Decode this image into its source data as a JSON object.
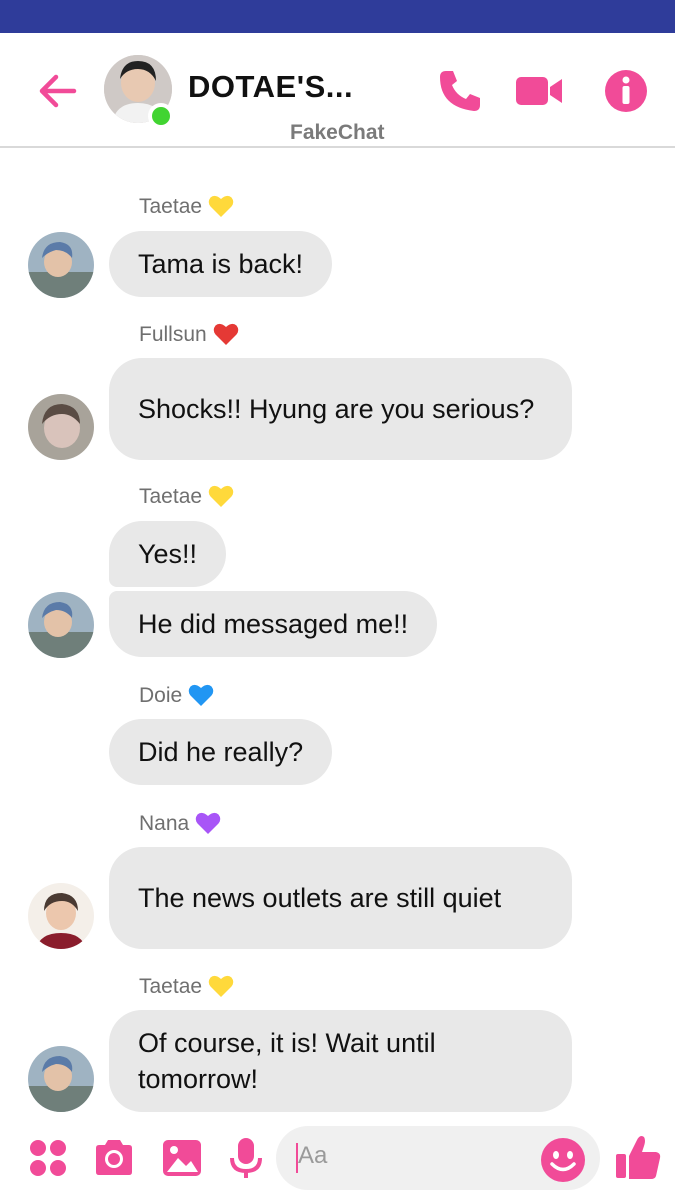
{
  "header": {
    "title": "DOTAE'S...",
    "subtitle": "FakeChat",
    "online": true,
    "accent_color": "#f14b98",
    "icons": [
      "back-arrow-icon",
      "phone-icon",
      "video-camera-icon",
      "info-icon"
    ]
  },
  "messages": [
    {
      "sender": "Taetae",
      "heart_color": "#ffd93b",
      "texts": [
        "Tama is back!"
      ]
    },
    {
      "sender": "Fullsun",
      "heart_color": "#e53935",
      "texts": [
        "Shocks!!  Hyung are you serious?"
      ]
    },
    {
      "sender": "Taetae",
      "heart_color": "#ffd93b",
      "texts": [
        "Yes!!",
        "He did messaged me!!"
      ]
    },
    {
      "sender": "Doie",
      "heart_color": "#2196f3",
      "texts": [
        "Did he really?"
      ]
    },
    {
      "sender": "Nana",
      "heart_color": "#a855f7",
      "texts": [
        "The news outlets are still quiet"
      ]
    },
    {
      "sender": "Taetae",
      "heart_color": "#ffd93b",
      "texts": [
        "Of course, it is! Wait until tomorrow!"
      ]
    }
  ],
  "composer": {
    "placeholder": "Aa",
    "icons": [
      "apps-icon",
      "camera-icon",
      "image-icon",
      "microphone-icon",
      "emoji-icon",
      "thumbs-up-icon"
    ]
  }
}
